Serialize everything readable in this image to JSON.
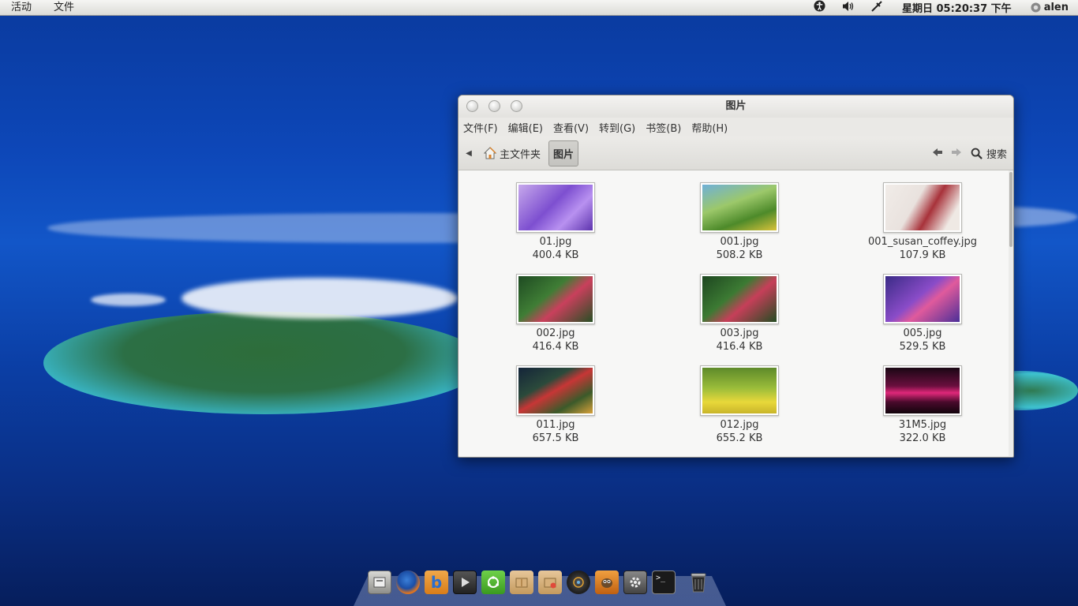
{
  "top_panel": {
    "activities": "活动",
    "app_menu": "文件",
    "clock": "星期日 05:20:37 下午",
    "user": "alen"
  },
  "window": {
    "title": "图片",
    "menu": [
      "文件(F)",
      "编辑(E)",
      "查看(V)",
      "转到(G)",
      "书签(B)",
      "帮助(H)"
    ],
    "breadcrumb": {
      "home": "主文件夹",
      "current": "图片"
    },
    "search_label": "搜索",
    "files": [
      {
        "name": "01.jpg",
        "size": "400.4 KB"
      },
      {
        "name": "001.jpg",
        "size": "508.2 KB"
      },
      {
        "name": "001_susan_coffey.jpg",
        "size": "107.9 KB"
      },
      {
        "name": "002.jpg",
        "size": "416.4 KB"
      },
      {
        "name": "003.jpg",
        "size": "416.4 KB"
      },
      {
        "name": "005.jpg",
        "size": "529.5 KB"
      },
      {
        "name": "011.jpg",
        "size": "657.5 KB"
      },
      {
        "name": "012.jpg",
        "size": "655.2 KB"
      },
      {
        "name": "31M5.jpg",
        "size": "322.0 KB"
      }
    ]
  },
  "dock": {
    "icons": [
      "file-manager-icon",
      "firefox-icon",
      "bookmark-b-icon",
      "video-player-icon",
      "ubuntu-software-icon",
      "package-icon",
      "package-installer-icon",
      "media-icon",
      "gimp-icon",
      "settings-gear-icon",
      "terminal-icon",
      "trash-icon"
    ]
  }
}
